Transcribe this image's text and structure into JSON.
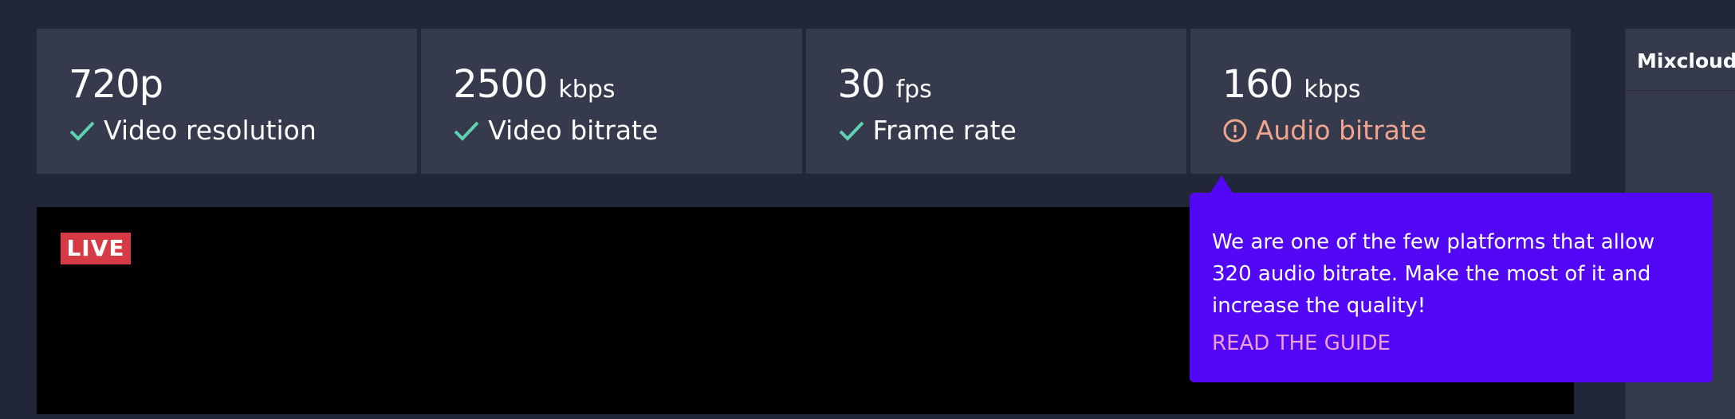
{
  "stats": [
    {
      "value": "720p",
      "unit": "",
      "label": "Video resolution",
      "status": "ok"
    },
    {
      "value": "2500",
      "unit": "kbps",
      "label": "Video bitrate",
      "status": "ok"
    },
    {
      "value": "30",
      "unit": "fps",
      "label": "Frame rate",
      "status": "ok"
    },
    {
      "value": "160",
      "unit": "kbps",
      "label": "Audio bitrate",
      "status": "warning"
    }
  ],
  "player": {
    "live_badge": "LIVE"
  },
  "side_panel": {
    "title": "Mixcloud Li"
  },
  "tooltip": {
    "text": "We are one of the few platforms that allow 320 audio bitrate. Make the most of it and increase the quality!",
    "link_label": "READ THE GUIDE"
  },
  "colors": {
    "background": "#222639",
    "card": "#353a4d",
    "ok": "#5fd3b0",
    "warning": "#f2a48f",
    "tooltip": "#5208f5",
    "link": "#f0a0d8",
    "live": "#d63a44"
  },
  "icons": {
    "ok": "check-icon",
    "warning": "exclamation-circle-icon"
  }
}
